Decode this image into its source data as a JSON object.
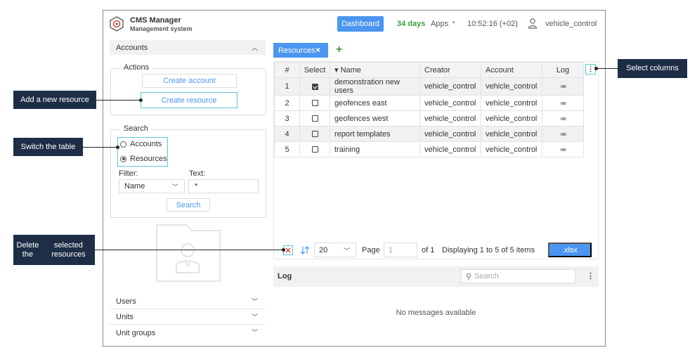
{
  "header": {
    "app_title": "CMS Manager",
    "app_subtitle": "Management system",
    "dashboard_label": "Dashboard",
    "days_label": "34 days",
    "apps_label": "Apps",
    "apps_arrow": "▾",
    "time": "10:52:16 (+02)",
    "username": "vehicle_control"
  },
  "sidebar": {
    "accounts_header": "Accounts",
    "actions_legend": "Actions",
    "create_account": "Create account",
    "create_resource": "Create resource",
    "search_legend": "Search",
    "radio_accounts": "Accounts",
    "radio_resources": "Resources",
    "filter_label": "Filter:",
    "text_label": "Text:",
    "filter_value": "Name",
    "text_value": "*",
    "search_button": "Search",
    "sections": [
      {
        "label": "Users"
      },
      {
        "label": "Units"
      },
      {
        "label": "Unit groups"
      }
    ]
  },
  "tabs": {
    "resources_label": "Resources",
    "close_glyph": "×",
    "add_glyph": "+"
  },
  "grid": {
    "columns": [
      "#",
      "Select",
      "▾ Name",
      "Creator",
      "Account",
      "Log"
    ],
    "rows": [
      {
        "num": "1",
        "checked": true,
        "name": "demonstration new users",
        "creator": "vehicle_control",
        "account": "vehicle_control"
      },
      {
        "num": "2",
        "checked": false,
        "name": "geofences east",
        "creator": "vehicle_control",
        "account": "vehicle_control"
      },
      {
        "num": "3",
        "checked": false,
        "name": "geofences west",
        "creator": "vehicle_control",
        "account": "vehicle_control"
      },
      {
        "num": "4",
        "checked": false,
        "name": "report templates",
        "creator": "vehicle_control",
        "account": "vehicle_control"
      },
      {
        "num": "5",
        "checked": false,
        "name": "training",
        "creator": "vehicle_control",
        "account": "vehicle_control"
      }
    ],
    "log_glyph": "≔",
    "columns_menu_glyph": "⋮"
  },
  "pager": {
    "delete_glyph": "✕",
    "page_size": "20",
    "page_label": "Page",
    "page_value": "1",
    "of_label": "of 1",
    "display_text": "Displaying 1 to 5 of 5 items",
    "export_label": ".xlsx"
  },
  "log": {
    "title": "Log",
    "search_placeholder": "Search",
    "menu_glyph": "⋮",
    "empty_text": "No messages available"
  },
  "callouts": {
    "add_resource": "Add a new resource",
    "switch_table": "Switch the table",
    "delete_line1": "Delete the",
    "delete_line2": "selected resources",
    "select_columns": "Select columns"
  },
  "colors": {
    "accent": "#4a96f0",
    "highlight": "#58c7d6",
    "days": "#38a13b",
    "callout_bg": "#1d2e46"
  }
}
